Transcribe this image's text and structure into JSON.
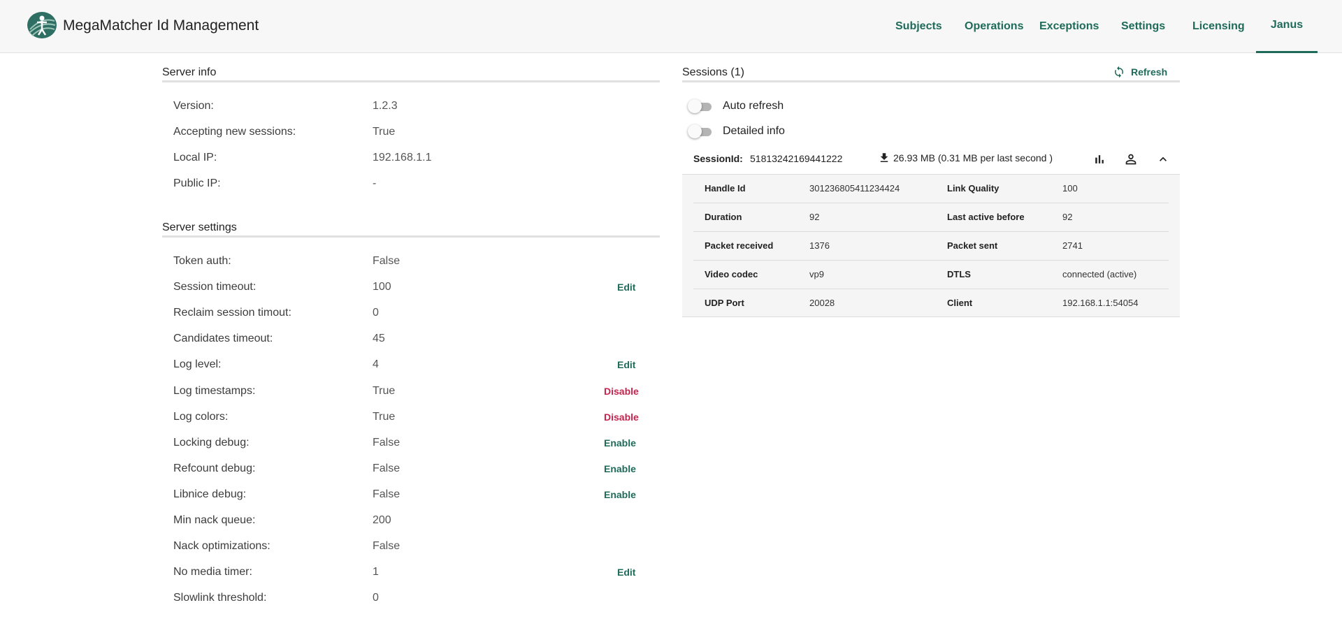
{
  "app": {
    "title": "MegaMatcher Id Management"
  },
  "nav": {
    "subjects": "Subjects",
    "operations": "Operations",
    "exceptions": "Exceptions",
    "settings": "Settings",
    "licensing": "Licensing",
    "janus": "Janus",
    "active": "janus"
  },
  "server_info": {
    "title": "Server info",
    "rows": [
      {
        "label": "Version:",
        "value": "1.2.3"
      },
      {
        "label": "Accepting new sessions:",
        "value": "True"
      },
      {
        "label": "Local IP:",
        "value": "192.168.1.1"
      },
      {
        "label": "Public IP:",
        "value": "-"
      }
    ]
  },
  "server_settings": {
    "title": "Server settings",
    "rows": [
      {
        "label": "Token auth:",
        "value": "False",
        "action": ""
      },
      {
        "label": "Session timeout:",
        "value": "100",
        "action": "Edit"
      },
      {
        "label": "Reclaim session timout:",
        "value": "0",
        "action": ""
      },
      {
        "label": "Candidates timeout:",
        "value": "45",
        "action": ""
      },
      {
        "label": "Log level:",
        "value": "4",
        "action": "Edit"
      },
      {
        "label": "Log timestamps:",
        "value": "True",
        "action": "Disable"
      },
      {
        "label": "Log colors:",
        "value": "True",
        "action": "Disable"
      },
      {
        "label": "Locking debug:",
        "value": "False",
        "action": "Enable"
      },
      {
        "label": "Refcount debug:",
        "value": "False",
        "action": "Enable"
      },
      {
        "label": "Libnice debug:",
        "value": "False",
        "action": "Enable"
      },
      {
        "label": "Min nack queue:",
        "value": "200",
        "action": ""
      },
      {
        "label": "Nack optimizations:",
        "value": "False",
        "action": ""
      },
      {
        "label": "No media timer:",
        "value": "1",
        "action": "Edit"
      },
      {
        "label": "Slowlink threshold:",
        "value": "0",
        "action": ""
      }
    ]
  },
  "sessions": {
    "title": "Sessions (1)",
    "refresh_label": "Refresh",
    "auto_refresh_label": "Auto refresh",
    "auto_refresh_on": false,
    "detailed_info_label": "Detailed info",
    "detailed_info_on": false,
    "session": {
      "id_label": "SessionId:",
      "id": "51813242169441222",
      "download": "26.93 MB (0.31 MB per last second )",
      "details": [
        {
          "k1": "Handle Id",
          "v1": "301236805411234424",
          "k2": "Link Quality",
          "v2": "100"
        },
        {
          "k1": "Duration",
          "v1": "92",
          "k2": "Last active before",
          "v2": "92"
        },
        {
          "k1": "Packet received",
          "v1": "1376",
          "k2": "Packet sent",
          "v2": "2741"
        },
        {
          "k1": "Video codec",
          "v1": "vp9",
          "k2": "DTLS",
          "v2": "connected (active)"
        },
        {
          "k1": "UDP Port",
          "v1": "20028",
          "k2": "Client",
          "v2": "192.168.1.1:54054"
        }
      ]
    }
  },
  "colors": {
    "accent": "#1f6b5a",
    "danger": "#c8234c"
  },
  "icons": [
    "app-logo",
    "refresh-icon",
    "download-icon",
    "bar-chart-icon",
    "person-icon",
    "chevron-up-icon"
  ]
}
